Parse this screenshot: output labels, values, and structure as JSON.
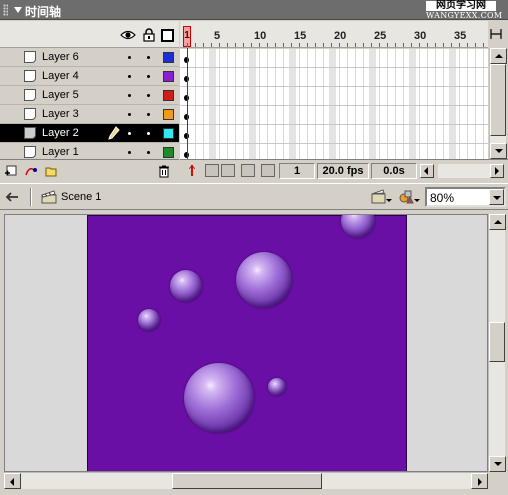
{
  "panel": {
    "title": "时间轴",
    "watermark_line1": "网页学习网",
    "watermark_line2": "WANGYEXX.COM"
  },
  "layers": [
    {
      "name": "Layer 6",
      "color": "#1c2fd6",
      "selected": false
    },
    {
      "name": "Layer 4",
      "color": "#8a1ed1",
      "selected": false
    },
    {
      "name": "Layer 5",
      "color": "#d21d1d",
      "selected": false
    },
    {
      "name": "Layer 3",
      "color": "#f09a1a",
      "selected": false
    },
    {
      "name": "Layer 2",
      "color": "#33e6f0",
      "selected": true
    },
    {
      "name": "Layer 1",
      "color": "#1f8a2a",
      "selected": false
    }
  ],
  "icons": {
    "eye": "eye-icon",
    "lock": "lock-icon",
    "outline": "outline-icon",
    "pencil": "pencil-icon",
    "trash": "trash-icon",
    "scene": "scene-icon",
    "back": "back-arrow-icon"
  },
  "ruler": {
    "current_frame_label": "1",
    "marks": [
      "5",
      "10",
      "15",
      "20",
      "25",
      "30",
      "35"
    ]
  },
  "status": {
    "current_frame": "1",
    "fps": "20.0 fps",
    "elapsed": "0.0s"
  },
  "editbar": {
    "scene_label": "Scene 1",
    "zoom": "80%"
  },
  "stage": {
    "background_color": "#6a0fa6",
    "bubble_color": "#a070d8"
  }
}
